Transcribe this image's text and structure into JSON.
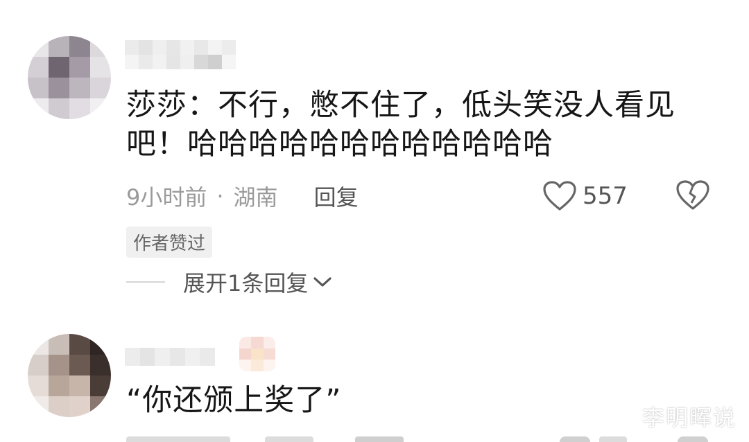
{
  "comments": [
    {
      "text_line1": "莎莎：不行，憋不住了，低头笑没人看见",
      "text_line2": "吧！哈哈哈哈哈哈哈哈哈哈哈哈",
      "time": "9小时前",
      "separator": "·",
      "location": "湖南",
      "reply_label": "回复",
      "like_count": "557",
      "badge": "作者赞过",
      "expand_label": "展开1条回复"
    },
    {
      "text": "“你还颁上奖了”"
    }
  ],
  "watermark": "李明晖说",
  "colors": {
    "text": "#161616",
    "meta": "#9a9a9a",
    "icon": "#666666",
    "badge_bg": "#f0f0f0"
  },
  "icons": [
    "heart-outline-icon",
    "broken-heart-icon",
    "chevron-down-icon"
  ]
}
